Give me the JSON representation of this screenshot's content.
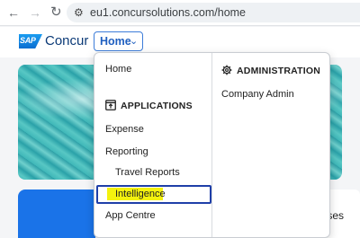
{
  "browser": {
    "back_glyph": "←",
    "forward_glyph": "→",
    "reload_glyph": "↻",
    "site_info_glyph": "⚙",
    "url": "eu1.concursolutions.com/home"
  },
  "header": {
    "sap_logo_text": "SAP",
    "brand": "Concur",
    "home_button": {
      "label": "Home",
      "chevron": "⌄"
    }
  },
  "dropdown": {
    "left_column": {
      "home": "Home",
      "applications_heading": "APPLICATIONS",
      "applications_icon": "applications-icon",
      "items": {
        "expense": "Expense",
        "reporting": "Reporting",
        "travel_reports": "Travel Reports",
        "intelligence": "Intelligence",
        "app_centre": "App Centre"
      }
    },
    "right_column": {
      "administration_heading": "ADMINISTRATION",
      "administration_icon": "gear-icon",
      "items": {
        "company_admin": "Company Admin"
      }
    }
  },
  "background_tiles": {
    "right_tile_text": "enses"
  },
  "colors": {
    "brand_blue": "#1a73e8",
    "focus_outline": "#1f3fa8",
    "highlight_yellow": "#f4f20e",
    "home_button": "#1f5fbf"
  }
}
